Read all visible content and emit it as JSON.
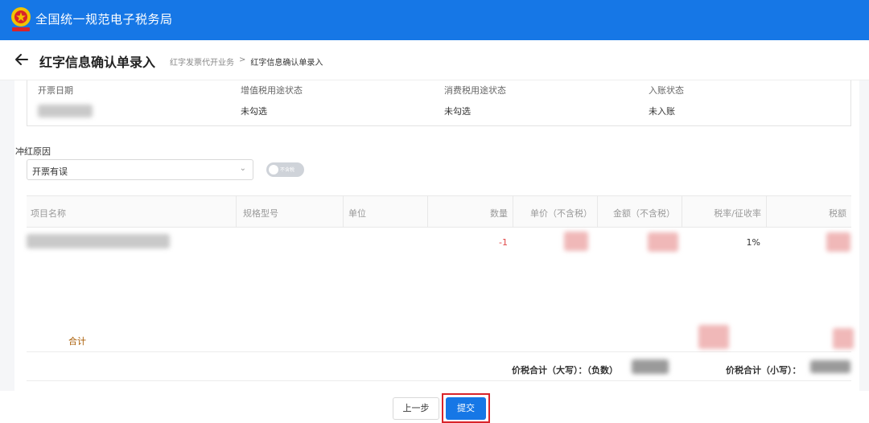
{
  "header": {
    "app_title": "全国统一规范电子税务局"
  },
  "titlebar": {
    "back_icon": "arrow-left-icon",
    "page_title": "红字信息确认单录入",
    "breadcrumb": [
      "红字发票代开业务",
      ">",
      "红字信息确认单录入"
    ]
  },
  "invoice_info": {
    "issue_date_label": "开票日期",
    "vat_status_label": "增值税用途状态",
    "vat_status_value": "未勾选",
    "consumption_status_label": "消费税用途状态",
    "consumption_status_value": "未勾选",
    "account_status_label": "入账状态",
    "account_status_value": "未入账"
  },
  "reversal": {
    "reason_label": "冲红原因",
    "reason_value": "开票有误",
    "toggle_label": "不含税"
  },
  "table": {
    "columns": [
      "项目名称",
      "规格型号",
      "单位",
      "数量",
      "单价（不含税）",
      "金额（不含税）",
      "税率/征收率",
      "税额"
    ],
    "rows": [
      {
        "quantity": "-1",
        "tax_rate": "1%"
      }
    ]
  },
  "summary": {
    "sum_label": "合计",
    "total_upper_label": "价税合计（大写）：（负数）",
    "total_lower_label": "价税合计（小写）："
  },
  "footer": {
    "prev_label": "上一步",
    "submit_label": "提交"
  },
  "colors": {
    "brand": "#1677e6",
    "highlight": "#d9232a",
    "negative": "#e04848",
    "sum_label": "#a85a00"
  }
}
